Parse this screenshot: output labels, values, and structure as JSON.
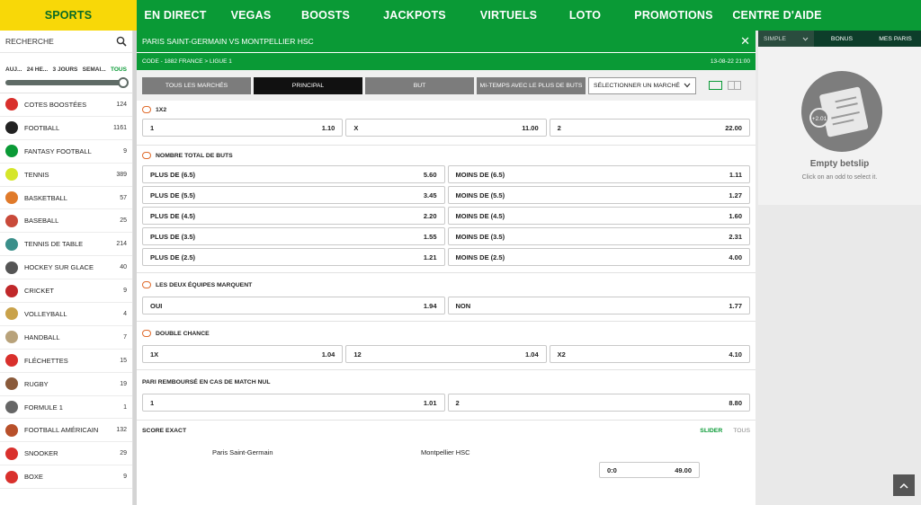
{
  "nav": {
    "items": [
      {
        "label": "SPORTS",
        "active": true
      },
      {
        "label": "EN DIRECT"
      },
      {
        "label": "VEGAS"
      },
      {
        "label": "BOOSTS"
      },
      {
        "label": "JACKPOTS"
      },
      {
        "label": "VIRTUELS"
      },
      {
        "label": "LOTO"
      },
      {
        "label": "PROMOTIONS"
      },
      {
        "label": "CENTRE D'AIDE"
      }
    ]
  },
  "sidebar": {
    "search_placeholder": "RECHERCHE",
    "time_filters": [
      "AUJ...",
      "24 HE...",
      "3 JOURS",
      "SEMAI...",
      "TOUS"
    ],
    "sports": [
      {
        "name": "COTES BOOSTÉES",
        "count": "124",
        "icon": "rocket-icon",
        "color": "#d9302c"
      },
      {
        "name": "FOOTBALL",
        "count": "1161",
        "icon": "football-icon",
        "color": "#222222"
      },
      {
        "name": "FANTASY FOOTBALL",
        "count": "9",
        "icon": "fantasy-football-icon",
        "color": "#0a9a36"
      },
      {
        "name": "TENNIS",
        "count": "389",
        "icon": "tennis-ball-icon",
        "color": "#d5e62a"
      },
      {
        "name": "BASKETBALL",
        "count": "57",
        "icon": "basketball-icon",
        "color": "#e07a2a"
      },
      {
        "name": "BASEBALL",
        "count": "25",
        "icon": "baseball-icon",
        "color": "#c94a3a"
      },
      {
        "name": "TENNIS DE TABLE",
        "count": "214",
        "icon": "table-tennis-icon",
        "color": "#3a8f8a"
      },
      {
        "name": "HOCKEY SUR GLACE",
        "count": "40",
        "icon": "hockey-puck-icon",
        "color": "#555555"
      },
      {
        "name": "CRICKET",
        "count": "9",
        "icon": "cricket-ball-icon",
        "color": "#c0282a"
      },
      {
        "name": "VOLLEYBALL",
        "count": "4",
        "icon": "volleyball-icon",
        "color": "#c9a24a"
      },
      {
        "name": "HANDBALL",
        "count": "7",
        "icon": "handball-icon",
        "color": "#b8a27a"
      },
      {
        "name": "FLÉCHETTES",
        "count": "15",
        "icon": "darts-icon",
        "color": "#d9302c"
      },
      {
        "name": "RUGBY",
        "count": "19",
        "icon": "rugby-ball-icon",
        "color": "#8a5a3a"
      },
      {
        "name": "FORMULE 1",
        "count": "1",
        "icon": "checkered-flag-icon",
        "color": "#666666"
      },
      {
        "name": "FOOTBALL AMÉRICAIN",
        "count": "132",
        "icon": "american-football-icon",
        "color": "#b8502a"
      },
      {
        "name": "SNOOKER",
        "count": "29",
        "icon": "snooker-icon",
        "color": "#d9302c"
      },
      {
        "name": "BOXE",
        "count": "9",
        "icon": "boxing-glove-icon",
        "color": "#d9302c"
      }
    ]
  },
  "match": {
    "title": "PARIS SAINT-GERMAIN VS MONTPELLIER HSC",
    "code": "CODE - 1882  FRANCE > LIGUE 1",
    "datetime": "13-08-22 21:00"
  },
  "filters": {
    "buttons": [
      {
        "label": "TOUS LES MARCHÉS"
      },
      {
        "label": "PRINCIPAL",
        "active": true
      },
      {
        "label": "BUT"
      },
      {
        "label": "MI-TEMPS AVEC LE PLUS DE BUTS"
      }
    ],
    "select_label": "SÉLECTIONNER UN MARCHÉ"
  },
  "markets": {
    "m1x2": {
      "title": "1X2",
      "odds": [
        [
          "1",
          "1.10"
        ],
        [
          "X",
          "11.00"
        ],
        [
          "2",
          "22.00"
        ]
      ]
    },
    "total": {
      "title": "NOMBRE TOTAL DE BUTS",
      "rows": [
        [
          "PLUS DE (6.5)",
          "5.60",
          "MOINS DE (6.5)",
          "1.11"
        ],
        [
          "PLUS DE (5.5)",
          "3.45",
          "MOINS DE (5.5)",
          "1.27"
        ],
        [
          "PLUS DE (4.5)",
          "2.20",
          "MOINS DE (4.5)",
          "1.60"
        ],
        [
          "PLUS DE (3.5)",
          "1.55",
          "MOINS DE (3.5)",
          "2.31"
        ],
        [
          "PLUS DE (2.5)",
          "1.21",
          "MOINS DE (2.5)",
          "4.00"
        ]
      ]
    },
    "btts": {
      "title": "LES DEUX ÉQUIPES MARQUENT",
      "odds": [
        [
          "OUI",
          "1.94"
        ],
        [
          "NON",
          "1.77"
        ]
      ]
    },
    "dc": {
      "title": "DOUBLE CHANCE",
      "odds": [
        [
          "1X",
          "1.04"
        ],
        [
          "12",
          "1.04"
        ],
        [
          "X2",
          "4.10"
        ]
      ]
    },
    "dnb": {
      "title": "PARI REMBOURSÉ EN CAS DE MATCH NUL",
      "odds": [
        [
          "1",
          "1.01"
        ],
        [
          "2",
          "8.80"
        ]
      ]
    },
    "score": {
      "title": "SCORE EXACT",
      "tab_slider": "SLIDER",
      "tab_all": "TOUS",
      "home": "Paris Saint-Germain",
      "away": "Montpellier HSC",
      "first": [
        "0:0",
        "49.00"
      ]
    }
  },
  "betslip": {
    "tab_simple": "SIMPLE",
    "tab_bonus": "BONUS",
    "tab_mybets": "MES PARIS",
    "badge": "+2.01",
    "empty_title": "Empty betslip",
    "empty_sub": "Click on an odd to select it."
  }
}
